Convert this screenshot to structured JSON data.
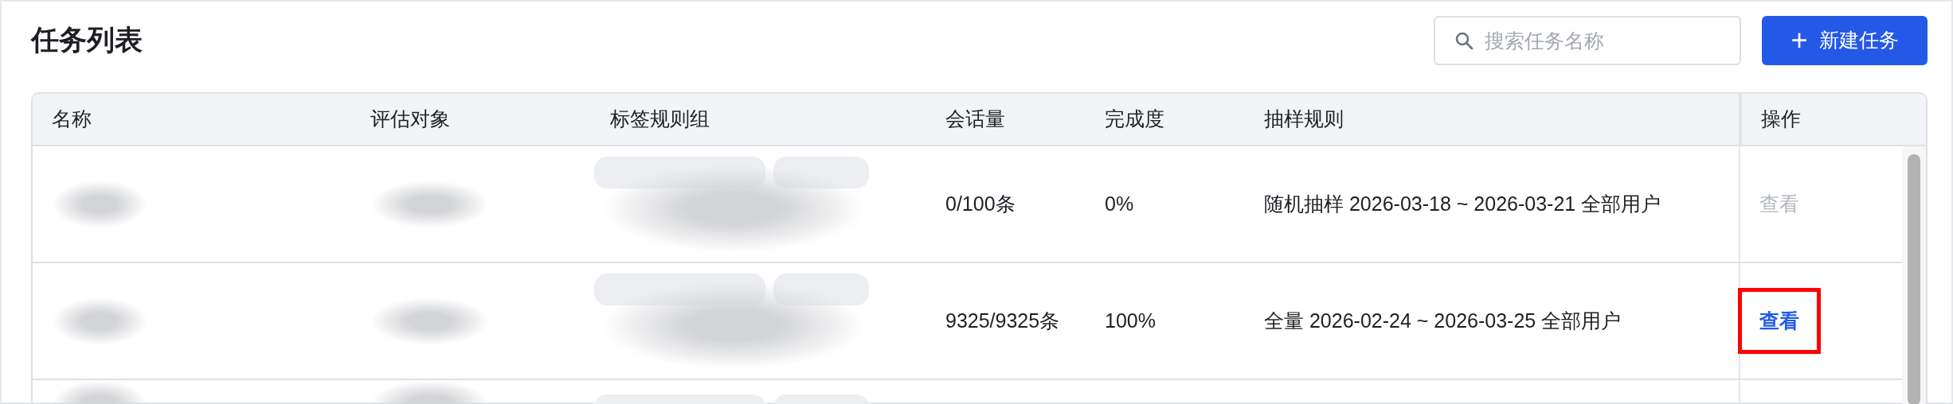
{
  "page_title": "任务列表",
  "search": {
    "placeholder": "搜索任务名称"
  },
  "new_button": {
    "icon": "+",
    "label": "新建任务"
  },
  "table": {
    "columns": [
      "名称",
      "评估对象",
      "标签规则组",
      "会话量",
      "完成度",
      "抽样规则",
      "操作"
    ],
    "rows": [
      {
        "redacted": true,
        "sessions": "0/100条",
        "progress": "0%",
        "sampling": "随机抽样 2026-03-18 ~ 2026-03-21 全部用户",
        "action": {
          "label": "查看",
          "disabled": true,
          "highlighted": false
        }
      },
      {
        "redacted": true,
        "sessions": "9325/9325条",
        "progress": "100%",
        "sampling": "全量 2026-02-24 ~ 2026-03-25 全部用户",
        "action": {
          "label": "查看",
          "disabled": false,
          "highlighted": true
        }
      },
      {
        "redacted": true
      }
    ]
  }
}
